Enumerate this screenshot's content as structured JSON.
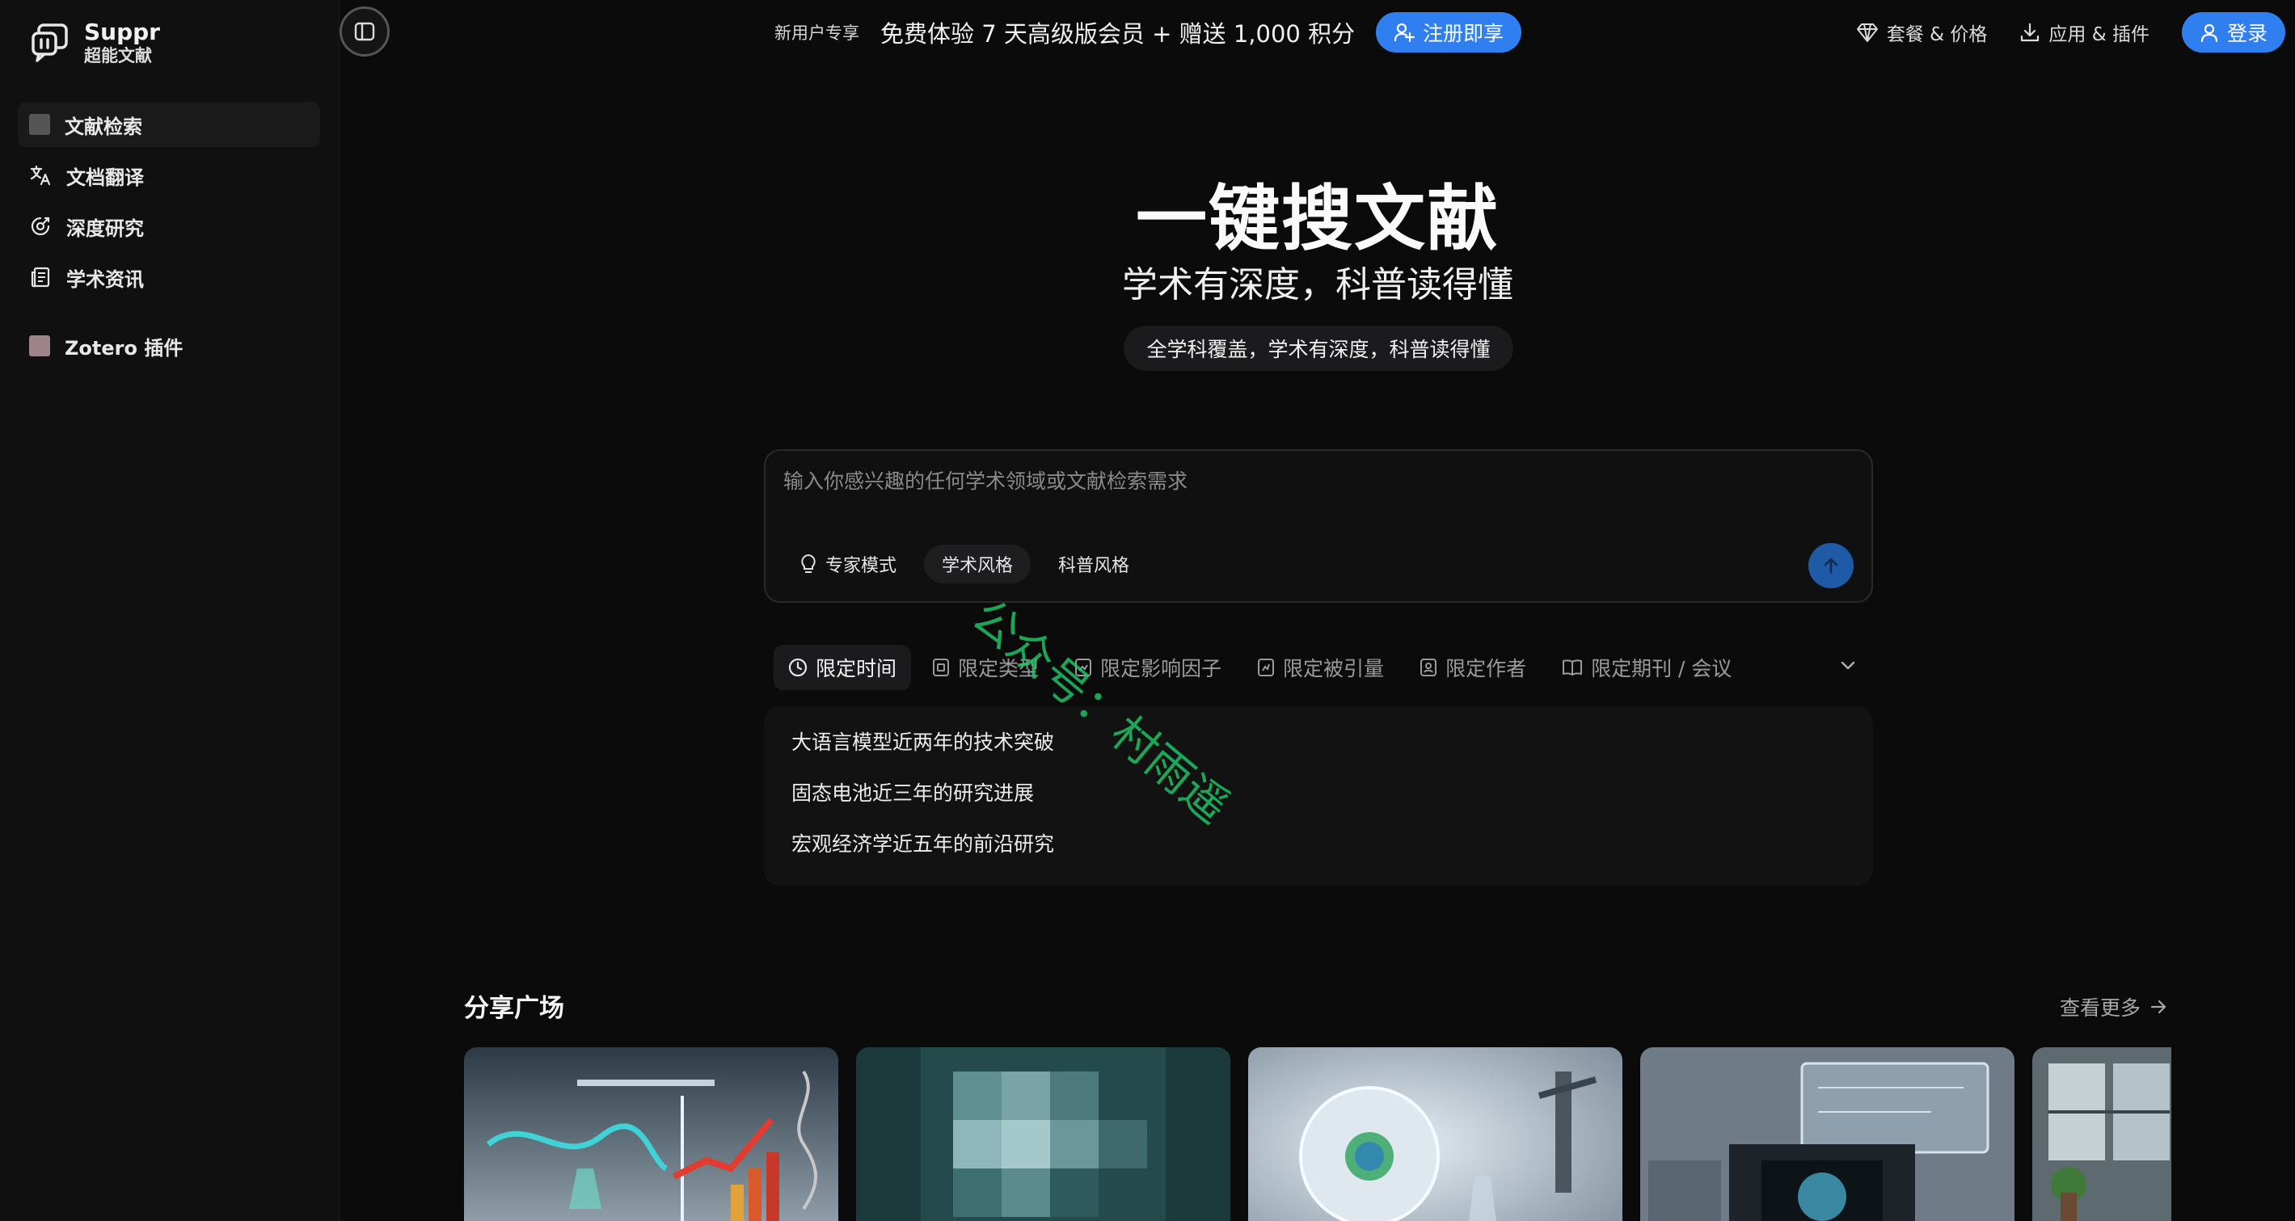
{
  "brand": {
    "name": "Suppr",
    "subtitle": "超能文献"
  },
  "sidebar": {
    "items": [
      {
        "label": "文献检索",
        "icon": "search-doc-icon"
      },
      {
        "label": "文档翻译",
        "icon": "translate-icon"
      },
      {
        "label": "深度研究",
        "icon": "deep-research-icon"
      },
      {
        "label": "学术资讯",
        "icon": "news-icon"
      },
      {
        "label": "Zotero 插件",
        "icon": "zotero-icon"
      }
    ]
  },
  "header": {
    "promo_tag": "新用户专享",
    "promo_text": "免费体验 7 天高级版会员 + 赠送 1,000 积分",
    "register_label": "注册即享",
    "pricing_label": "套餐 & 价格",
    "apps_label": "应用 & 插件",
    "login_label": "登录"
  },
  "hero": {
    "title": "一键搜文献",
    "subtitle": "学术有深度，科普读得懂",
    "pill": "全学科覆盖，学术有深度，科普读得懂"
  },
  "search": {
    "placeholder": "输入你感兴趣的任何学术领域或文献检索需求",
    "modes": [
      "专家模式",
      "学术风格",
      "科普风格"
    ]
  },
  "filters": [
    "限定时间",
    "限定类型",
    "限定影响因子",
    "限定被引量",
    "限定作者",
    "限定期刊 / 会议"
  ],
  "suggestions": [
    "大语言模型近两年的技术突破",
    "固态电池近三年的研究进展",
    "宏观经济学近五年的前沿研究"
  ],
  "share": {
    "title": "分享广场",
    "more_label": "查看更多"
  },
  "watermark": "公众号：村雨遥",
  "colors": {
    "accent": "#2f7ff0",
    "background": "#0b0b0c",
    "sidebar": "#101011"
  }
}
